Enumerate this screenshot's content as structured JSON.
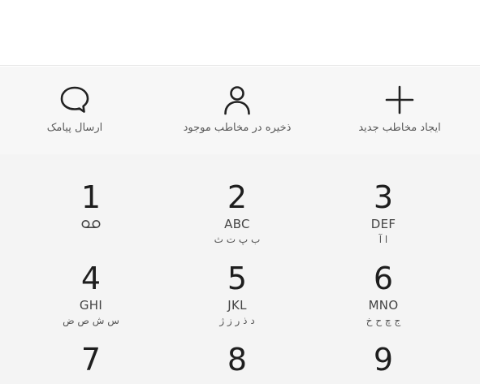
{
  "actions": {
    "send_sms": "ارسال پیامک",
    "save_existing": "ذخیره در مخاطب موجود",
    "new_contact": "ایجاد مخاطب جدید"
  },
  "keys": [
    {
      "digit": "1",
      "latin": "",
      "farsi": "",
      "icon": "voicemail-icon"
    },
    {
      "digit": "2",
      "latin": "ABC",
      "farsi": "ب پ ت ث"
    },
    {
      "digit": "3",
      "latin": "DEF",
      "farsi": "ا آ"
    },
    {
      "digit": "4",
      "latin": "GHI",
      "farsi": "س ش ص ض"
    },
    {
      "digit": "5",
      "latin": "JKL",
      "farsi": "د ذ ر ز ژ"
    },
    {
      "digit": "6",
      "latin": "MNO",
      "farsi": "ج چ ح خ"
    },
    {
      "digit": "7",
      "latin": "",
      "farsi": ""
    },
    {
      "digit": "8",
      "latin": "",
      "farsi": ""
    },
    {
      "digit": "9",
      "latin": "",
      "farsi": ""
    }
  ]
}
